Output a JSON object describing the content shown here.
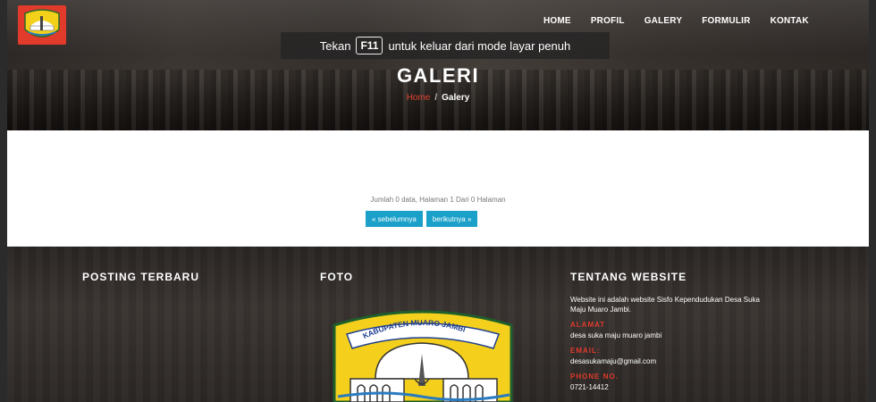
{
  "nav": {
    "items": [
      "HOME",
      "PROFIL",
      "GALERY",
      "FORMULIR",
      "KONTAK"
    ]
  },
  "fullscreen_notice": {
    "prefix": "Tekan",
    "key": "F11",
    "suffix": "untuk keluar dari mode layar penuh"
  },
  "page": {
    "title": "GALERI",
    "breadcrumb": {
      "home": "Home",
      "sep": "/",
      "current": "Galery"
    }
  },
  "content": {
    "data_info": "Jumlah 0 data, Halaman 1 Dari 0 Halaman",
    "prev_label": "« sebelumnya",
    "next_label": "berikutnya »"
  },
  "footer": {
    "col1_heading": "POSTING TERBARU",
    "col2_heading": "FOTO",
    "col3_heading": "TENTANG WEBSITE",
    "about_text": "Website ini adalah website Sisfo Kependudukan Desa Suka Maju Muaro Jambi.",
    "address_label": "ALAMAT",
    "address_value": "desa suka maju muaro jambi",
    "email_label": "EMAIL:",
    "email_value": "desasukamaju@gmail.com",
    "phone_label": "PHONE NO.",
    "phone_value": "0721-14412",
    "emblem_text": "KABUPATEN MUARO JAMBI"
  },
  "colors": {
    "accent": "#e0452f",
    "button": "#1aa0c9",
    "logo_bg": "#e23a2b"
  }
}
